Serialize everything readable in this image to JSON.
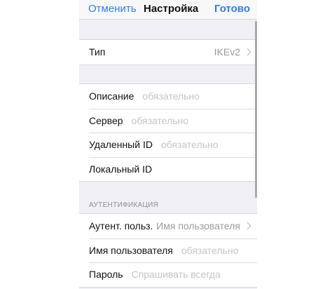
{
  "navbar": {
    "cancel_label": "Отменить",
    "title": "Настройка",
    "done_label": "Готово"
  },
  "type_group": {
    "label": "Тип",
    "value": "IKEv2"
  },
  "server_group": {
    "rows": [
      {
        "label": "Описание",
        "placeholder": "обязательно"
      },
      {
        "label": "Сервер",
        "placeholder": "обязательно"
      },
      {
        "label": "Удаленный ID",
        "placeholder": "обязательно"
      },
      {
        "label": "Локальный ID",
        "placeholder": ""
      }
    ]
  },
  "auth_group": {
    "header": "АУТЕНТИФИКАЦИЯ",
    "auth_type_label": "Аутент. польз.",
    "auth_type_value": "Имя пользователя",
    "username_label": "Имя пользователя",
    "username_placeholder": "обязательно",
    "password_label": "Пароль",
    "password_placeholder": "Спрашивать всегда"
  },
  "colors": {
    "accent": "#2f7df6",
    "grouped_background": "#efeff4",
    "placeholder": "#c5c5ca"
  },
  "icons": {
    "disclosure": "chevron-right-icon"
  }
}
